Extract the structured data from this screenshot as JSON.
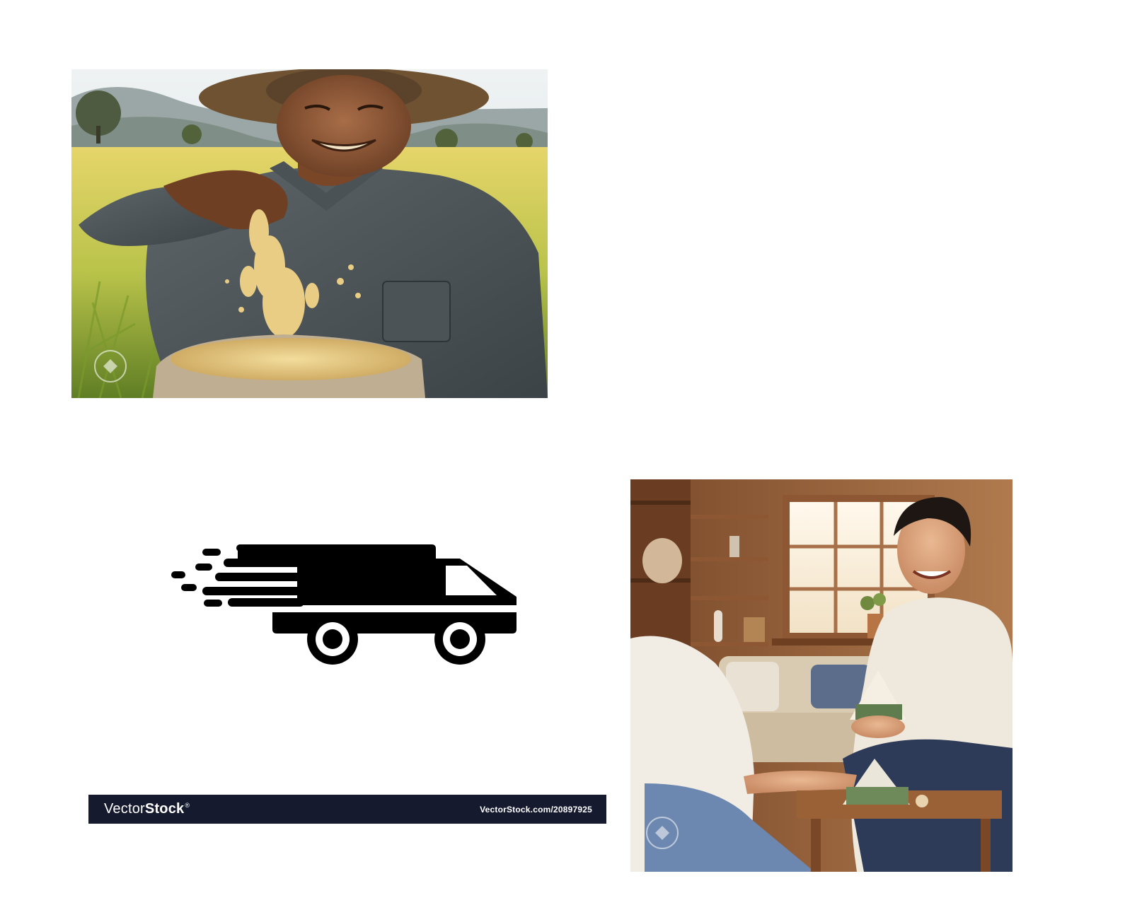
{
  "images": {
    "farmer": {
      "icon": "farmer-rice-photo"
    },
    "delivery": {
      "icon": "delivery-truck-icon"
    },
    "livingroom": {
      "icon": "living-room-photo"
    }
  },
  "vectorstock": {
    "brand_light": "Vector",
    "brand_bold": "Stock",
    "brand_mark": "®",
    "url": "VectorStock.com/20897925"
  },
  "colors": {
    "banner_bg": "#161a2f",
    "banner_text": "#ffffff",
    "truck": "#000000",
    "background": "#ffffff"
  }
}
